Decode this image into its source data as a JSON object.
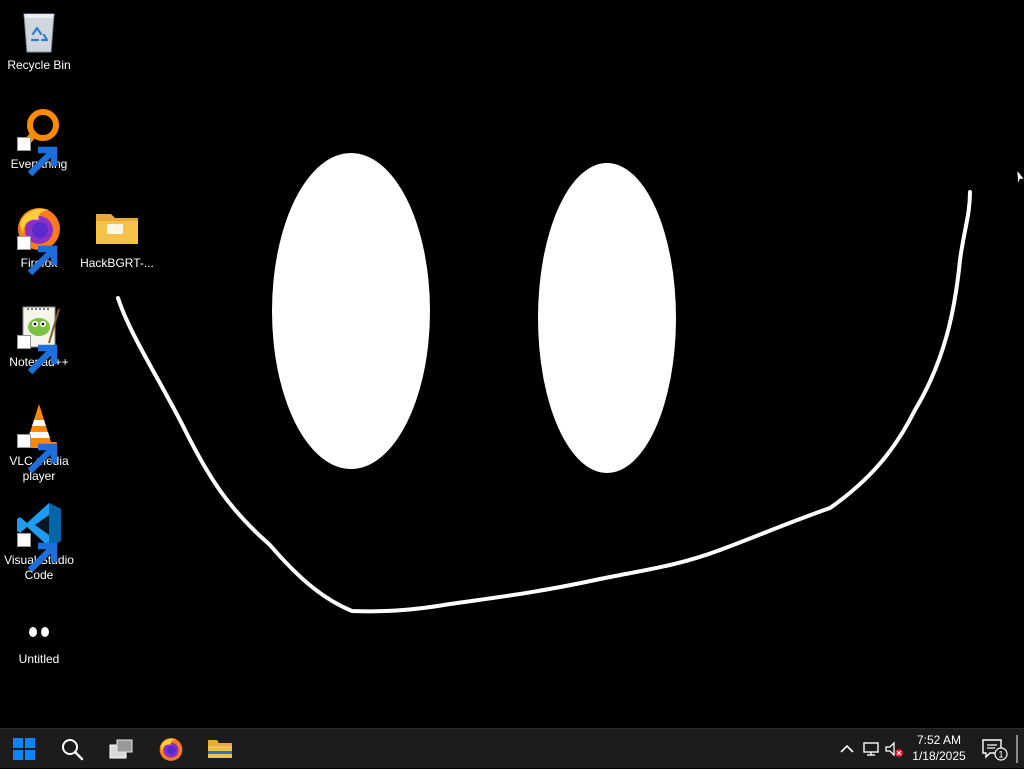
{
  "desktop": {
    "icons": [
      {
        "label": "Recycle Bin",
        "icon": "recycle-bin-icon"
      },
      {
        "label": "Everything",
        "icon": "everything-search-icon"
      },
      {
        "label": "Firefox",
        "icon": "firefox-icon"
      },
      {
        "label": "HackBGRT-...",
        "icon": "folder-icon"
      },
      {
        "label": "Notepad++",
        "icon": "notepad-plus-plus-icon"
      },
      {
        "label": "VLC media player",
        "icon": "vlc-icon"
      },
      {
        "label": "Visual Studio Code",
        "icon": "vscode-icon"
      },
      {
        "label": "Untitled",
        "icon": "eyes-icon"
      }
    ]
  },
  "taskbar": {
    "buttons": [
      "start-icon",
      "search-icon",
      "task-view-icon",
      "firefox-icon",
      "file-explorer-icon"
    ],
    "tray": {
      "chevron": "chevron-up-icon",
      "network": "network-icon",
      "volume": "volume-muted-icon"
    },
    "clock": {
      "time": "7:52 AM",
      "date": "1/18/2025"
    },
    "notifications": {
      "icon": "notification-icon",
      "count": "1"
    }
  },
  "colors": {
    "desktop_bg": "#000000",
    "taskbar_bg": "#1c1c1c",
    "start_blue": "#0a84ff",
    "folder_yellow": "#f4c247"
  }
}
